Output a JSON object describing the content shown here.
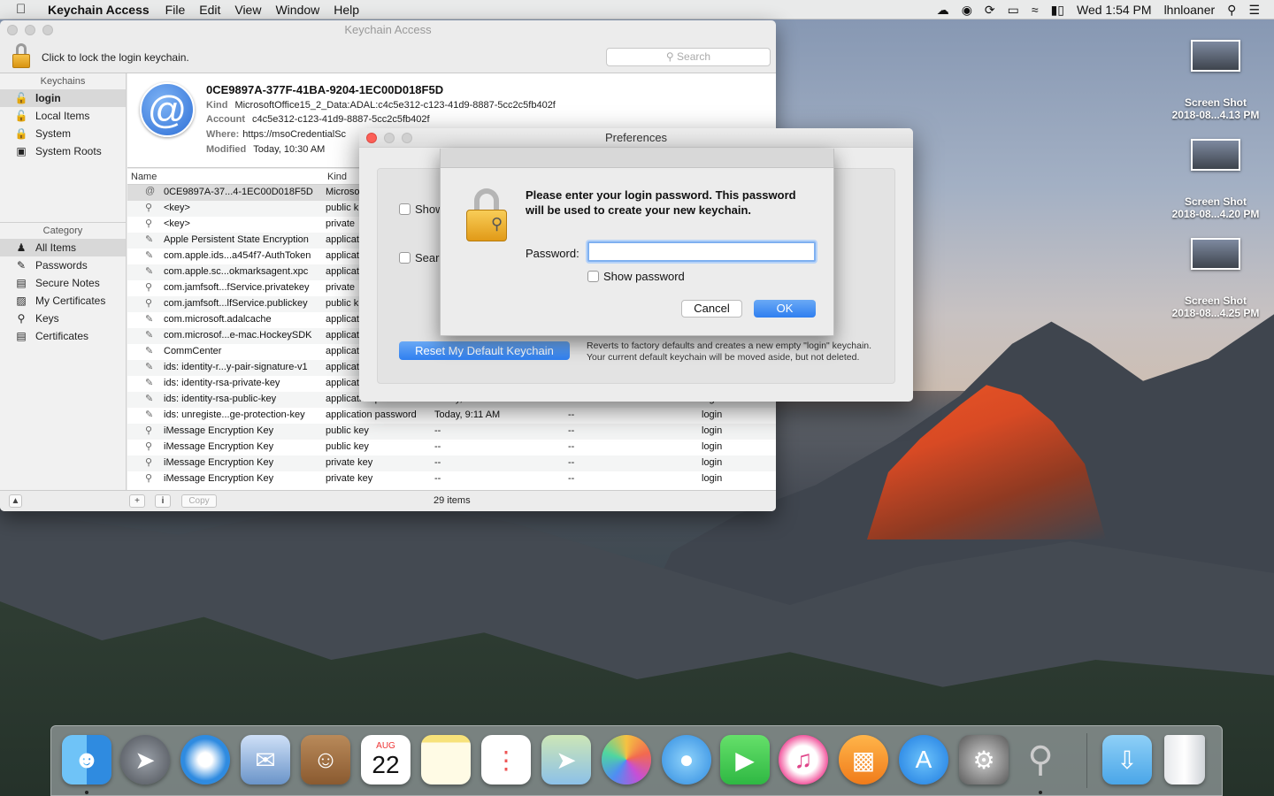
{
  "menubar": {
    "app_name": "Keychain Access",
    "items": [
      "File",
      "Edit",
      "View",
      "Window",
      "Help"
    ],
    "clock": "Wed 1:54 PM",
    "user": "lhnloaner"
  },
  "window": {
    "title": "Keychain Access",
    "lock_text": "Click to lock the login keychain.",
    "search_placeholder": "Search",
    "keychains_header": "Keychains",
    "keychains": [
      "login",
      "Local Items",
      "System",
      "System Roots"
    ],
    "category_header": "Category",
    "categories": [
      "All Items",
      "Passwords",
      "Secure Notes",
      "My Certificates",
      "Keys",
      "Certificates"
    ],
    "detail": {
      "title": "0CE9897A-377F-41BA-9204-1EC00D018F5D",
      "kind_label": "Kind",
      "kind": "MicrosoftOffice15_2_Data:ADAL:c4c5e312-c123-41d9-8887-5cc2c5fb402f",
      "account_label": "Account",
      "account": "c4c5e312-c123-41d9-8887-5cc2c5fb402f",
      "where_label": "Where:",
      "where": "https://msoCredentialSc",
      "modified_label": "Modified",
      "modified": "Today, 10:30 AM"
    },
    "columns": {
      "name": "Name",
      "kind": "Kind"
    },
    "rows": [
      {
        "name": "0CE9897A-37...4-1EC00D018F5D",
        "kind": "Microso",
        "date": "",
        "expires": "",
        "keychain": ""
      },
      {
        "name": "<key>",
        "kind": "public k",
        "date": "",
        "expires": "",
        "keychain": ""
      },
      {
        "name": "<key>",
        "kind": "private",
        "date": "",
        "expires": "",
        "keychain": ""
      },
      {
        "name": "Apple Persistent State Encryption",
        "kind": "applicat",
        "date": "",
        "expires": "",
        "keychain": ""
      },
      {
        "name": "com.apple.ids...a454f7-AuthToken",
        "kind": "applicat",
        "date": "",
        "expires": "",
        "keychain": ""
      },
      {
        "name": "com.apple.sc...okmarksagent.xpc",
        "kind": "applicat",
        "date": "",
        "expires": "",
        "keychain": ""
      },
      {
        "name": "com.jamfsoft...fService.privatekey",
        "kind": "private",
        "date": "",
        "expires": "",
        "keychain": ""
      },
      {
        "name": "com.jamfsoft...lfService.publickey",
        "kind": "public k",
        "date": "",
        "expires": "",
        "keychain": ""
      },
      {
        "name": "com.microsoft.adalcache",
        "kind": "applicat",
        "date": "",
        "expires": "",
        "keychain": ""
      },
      {
        "name": "com.microsof...e-mac.HockeySDK",
        "kind": "applicat",
        "date": "",
        "expires": "",
        "keychain": ""
      },
      {
        "name": "CommCenter",
        "kind": "applicat",
        "date": "",
        "expires": "",
        "keychain": ""
      },
      {
        "name": "ids: identity-r...y-pair-signature-v1",
        "kind": "applicat",
        "date": "",
        "expires": "",
        "keychain": ""
      },
      {
        "name": "ids: identity-rsa-private-key",
        "kind": "applicat",
        "date": "",
        "expires": "",
        "keychain": ""
      },
      {
        "name": "ids: identity-rsa-public-key",
        "kind": "application password",
        "date": "Today, 9:11 AM",
        "expires": "--",
        "keychain": "login"
      },
      {
        "name": "ids: unregiste...ge-protection-key",
        "kind": "application password",
        "date": "Today, 9:11 AM",
        "expires": "--",
        "keychain": "login"
      },
      {
        "name": "iMessage Encryption Key",
        "kind": "public key",
        "date": "--",
        "expires": "--",
        "keychain": "login"
      },
      {
        "name": "iMessage Encryption Key",
        "kind": "public key",
        "date": "--",
        "expires": "--",
        "keychain": "login"
      },
      {
        "name": "iMessage Encryption Key",
        "kind": "private key",
        "date": "--",
        "expires": "--",
        "keychain": "login"
      },
      {
        "name": "iMessage Encryption Key",
        "kind": "private key",
        "date": "--",
        "expires": "--",
        "keychain": "login"
      }
    ],
    "status": {
      "add": "+",
      "info": "i",
      "copy": "Copy",
      "count": "29 items"
    }
  },
  "preferences": {
    "title": "Preferences",
    "check1": "Show",
    "check2": "Searc",
    "reset_button": "Reset My Default Keychain",
    "reset_note_line1": "Reverts to factory defaults and creates a new empty \"login\" keychain.",
    "reset_note_line2": "Your current default keychain will be moved aside, but not deleted."
  },
  "dialog": {
    "message": "Please enter your login password. This password will be used to create your new keychain.",
    "password_label": "Password:",
    "password_value": "",
    "show_password": "Show password",
    "cancel": "Cancel",
    "ok": "OK"
  },
  "desktop": {
    "shots": [
      {
        "line1": "Screen Shot",
        "line2": "2018-08...4.13 PM"
      },
      {
        "line1": "Screen Shot",
        "line2": "2018-08...4.20 PM"
      },
      {
        "line1": "Screen Shot",
        "line2": "2018-08...4.25 PM"
      }
    ]
  },
  "dock": {
    "calendar_month": "AUG",
    "calendar_day": "22",
    "apps": [
      "Finder",
      "Launchpad",
      "Safari",
      "Mail",
      "Contacts",
      "Calendar",
      "Notes",
      "Reminders",
      "Maps",
      "Photos",
      "Messages",
      "FaceTime",
      "iTunes",
      "iBooks",
      "App Store",
      "System Preferences",
      "Keychain Access",
      "Downloads",
      "Trash"
    ]
  }
}
